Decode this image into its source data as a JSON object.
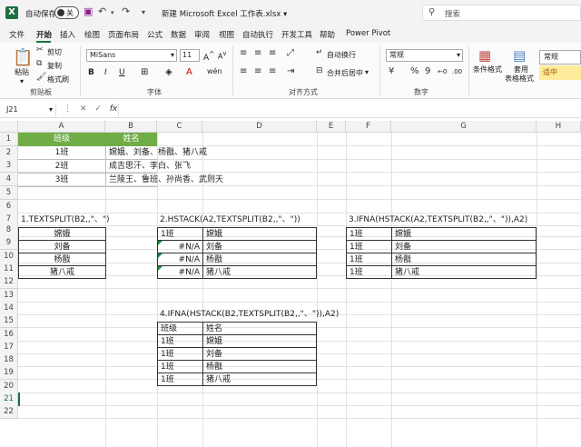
{
  "titlebar": {
    "autosave_label": "自动保存",
    "autosave_state": "关",
    "document_title": "新建 Microsoft Excel 工作表.xlsx",
    "search_placeholder": "搜索"
  },
  "tabs": [
    "文件",
    "开始",
    "插入",
    "绘图",
    "页面布局",
    "公式",
    "数据",
    "审阅",
    "视图",
    "自动执行",
    "开发工具",
    "帮助",
    "Power Pivot"
  ],
  "ribbon": {
    "clipboard": {
      "paste": "粘贴",
      "cut": "剪切",
      "copy": "复制",
      "format_painter": "格式刷",
      "label": "剪贴板"
    },
    "font": {
      "name": "MiSans",
      "size": "11",
      "label": "字体"
    },
    "alignment": {
      "wrap": "自动换行",
      "merge": "合并后居中",
      "label": "对齐方式"
    },
    "number": {
      "format": "常规",
      "label": "数字"
    },
    "styles": {
      "conditional": "条件格式",
      "table_format_l1": "套用",
      "table_format_l2": "表格格式",
      "normal": "常规",
      "neutral": "适中"
    }
  },
  "formula_bar": {
    "name_box": "J21",
    "fx": "fx"
  },
  "columns": [
    "A",
    "B",
    "C",
    "D",
    "E",
    "F",
    "G",
    "H"
  ],
  "rows": [
    "1",
    "2",
    "3",
    "4",
    "5",
    "6",
    "7",
    "8",
    "9",
    "10",
    "11",
    "12",
    "13",
    "14",
    "15",
    "16",
    "17",
    "18",
    "19",
    "20",
    "21",
    "22"
  ],
  "selected_row": "21",
  "source_table": {
    "headers": [
      "班级",
      "姓名"
    ],
    "rows": [
      [
        "1班",
        "嫦娥、刘备、杨戬、猪八戒"
      ],
      [
        "2班",
        "成吉思汗、李白、张飞"
      ],
      [
        "3班",
        "兰陵王、鲁班、孙尚香、武则天"
      ]
    ]
  },
  "example1": {
    "title": "1.TEXTSPLIT(B2,,\"、\")",
    "values": [
      "嫦娥",
      "刘备",
      "杨戬",
      "猪八戒"
    ]
  },
  "example2": {
    "title": "2.HSTACK(A2,TEXTSPLIT(B2,,\"、\"))",
    "rows": [
      [
        "1班",
        "嫦娥"
      ],
      [
        "#N/A",
        "刘备"
      ],
      [
        "#N/A",
        "杨戬"
      ],
      [
        "#N/A",
        "猪八戒"
      ]
    ]
  },
  "example3": {
    "title": "3.IFNA(HSTACK(A2,TEXTSPLIT(B2,,\"、\")),A2)",
    "rows": [
      [
        "1班",
        "嫦娥"
      ],
      [
        "1班",
        "刘备"
      ],
      [
        "1班",
        "杨戬"
      ],
      [
        "1班",
        "猪八戒"
      ]
    ]
  },
  "example4": {
    "title": "4.IFNA(HSTACK(B2,TEXTSPLIT(B2,,\"、\")),A2)",
    "rows": [
      [
        "班级",
        "姓名"
      ],
      [
        "1班",
        "嫦娥"
      ],
      [
        "1班",
        "刘备"
      ],
      [
        "1班",
        "杨戬"
      ],
      [
        "1班",
        "猪八戒"
      ]
    ]
  },
  "colors": {
    "brand": "#1d6f42",
    "header_fill": "#70ad47",
    "neutral_fill": "#ffeb9c"
  }
}
